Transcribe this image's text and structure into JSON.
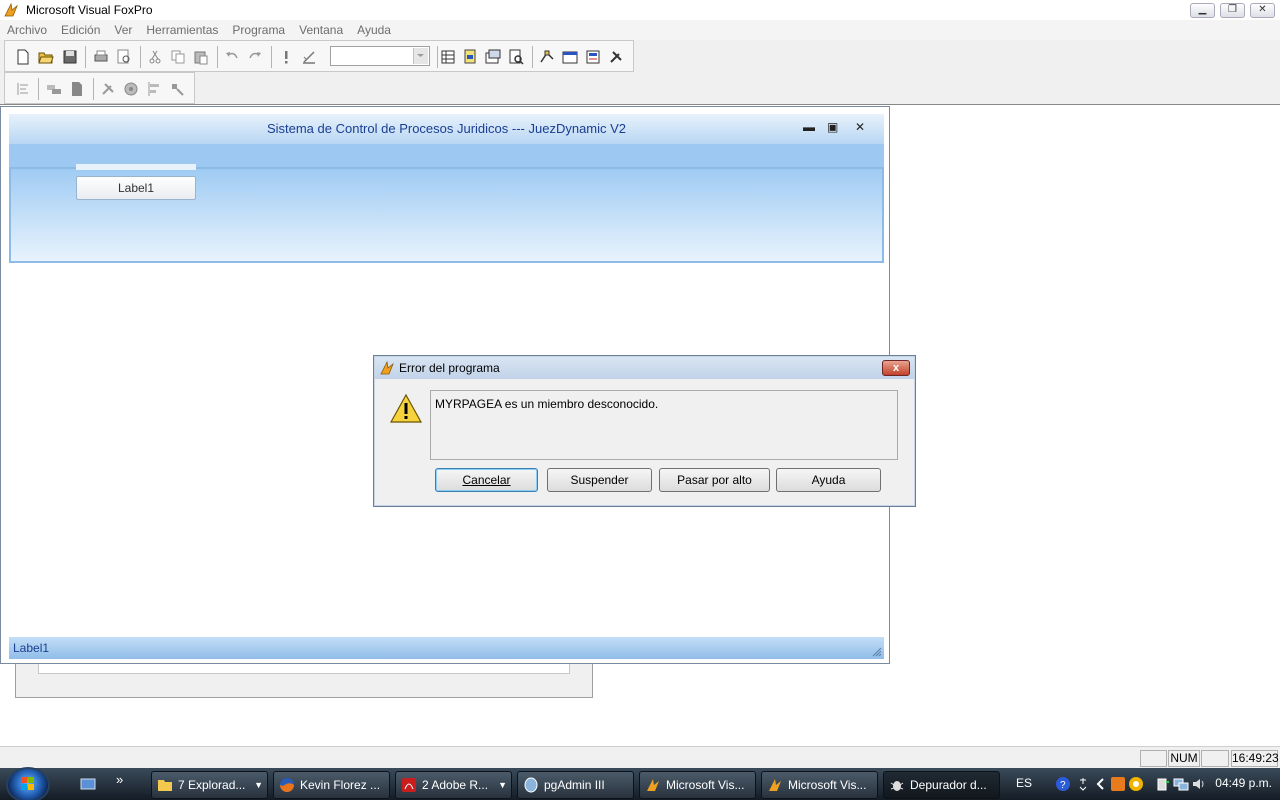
{
  "app": {
    "title": "Microsoft Visual FoxPro",
    "window_controls": [
      "minimize",
      "restore",
      "close"
    ]
  },
  "menu": [
    "Archivo",
    "Edición",
    "Ver",
    "Herramientas",
    "Programa",
    "Ventana",
    "Ayuda"
  ],
  "toolbar": {
    "standard_icons": [
      "new-file-icon",
      "open-folder-icon",
      "save-icon",
      "print-icon",
      "print-preview-icon",
      "cut-icon",
      "copy-icon",
      "paste-icon",
      "undo-icon",
      "redo-icon",
      "run-icon",
      "modify-form-icon",
      "data-session-icon",
      "command-window-icon",
      "properties-icon",
      "code-icon",
      "form-designer-icon",
      "builder-icon"
    ],
    "combo_value": "",
    "second_row_icons": [
      "align-left-icon",
      "tab-order-icon",
      "page-icon",
      "tools-icon",
      "network-icon",
      "align-icon",
      "wizard-icon"
    ]
  },
  "form": {
    "title": "Sistema de Control de Procesos Juridicos --- JuezDynamic V2",
    "label1": "Label1",
    "status_label": "Label1",
    "controls": [
      "minimize",
      "maximize",
      "close"
    ]
  },
  "dialog": {
    "title": "Error del programa",
    "message": "MYRPAGEA es un miembro desconocido.",
    "buttons": {
      "cancel": "Cancelar",
      "suspend": "Suspender",
      "ignore": "Pasar por alto",
      "help": "Ayuda"
    },
    "close_label": "x"
  },
  "statusbar": {
    "num": "NUM",
    "time": "16:49:23"
  },
  "taskbar": {
    "items": [
      {
        "label": "7 Explorad...",
        "icon": "folder-icon"
      },
      {
        "label": "Kevin Florez ...",
        "icon": "firefox-icon"
      },
      {
        "label": "2 Adobe R...",
        "icon": "adobe-reader-icon"
      },
      {
        "label": "pgAdmin III",
        "icon": "pgadmin-icon"
      },
      {
        "label": "Microsoft Vis...",
        "icon": "foxpro-icon"
      },
      {
        "label": "Microsoft Vis...",
        "icon": "foxpro-icon"
      },
      {
        "label": "Depurador d...",
        "icon": "debugger-icon"
      }
    ],
    "language": "ES",
    "clock": "04:49 p.m.",
    "quicklaunch_more": "»"
  }
}
